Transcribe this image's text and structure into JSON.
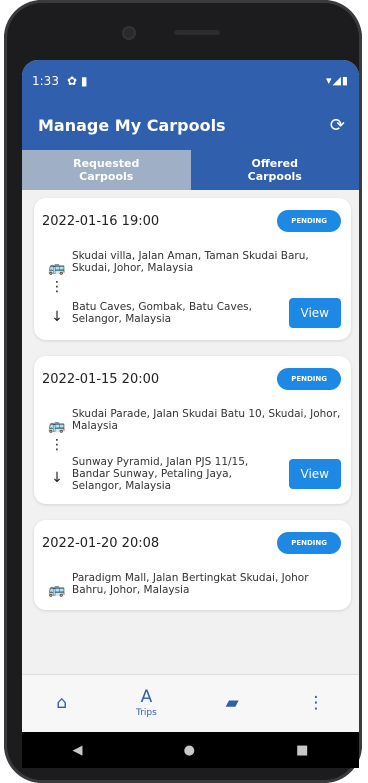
{
  "status_bar": {
    "time": "1:33",
    "icons_left": "✿ ▮",
    "icons_right": "▾◢▮"
  },
  "app_bar": {
    "title": "Manage My Carpools",
    "refresh_icon": "⟳"
  },
  "tabs": [
    {
      "label": "Requested Carpools",
      "active": true
    },
    {
      "label": "Offered Carpools",
      "active": false
    }
  ],
  "cards": [
    {
      "datetime": "2022-01-16 19:00",
      "status": "PENDING",
      "from": "Skudai villa, Jalan Aman, Taman Skudai Baru, Skudai, Johor, Malaysia",
      "to": "Batu Caves, Gombak, Batu Caves, Selangor, Malaysia",
      "button": "View"
    },
    {
      "datetime": "2022-01-15 20:00",
      "status": "PENDING",
      "from": "Skudai Parade, Jalan Skudai Batu 10, Skudai, Johor, Malaysia",
      "to": "Sunway Pyramid, Jalan PJS 11/15, Bandar Sunway, Petaling Jaya, Selangor, Malaysia",
      "button": "View"
    },
    {
      "datetime": "2022-01-20 20:08",
      "status": "PENDING",
      "from": "Paradigm Mall, Jalan Bertingkat Skudai, Johor Bahru, Johor, Malaysia",
      "to": "",
      "button": ""
    }
  ],
  "bottom_nav": {
    "home_icon": "home-icon",
    "trips_label": "Trips",
    "chat_icon": "chat-icon",
    "more_icon": "more-icon"
  },
  "glyphs": {
    "bus": "🚌",
    "dots": "⋮",
    "arrow": "↓",
    "trips": "A",
    "home": "⌂",
    "chat": "▰",
    "more": "⋮"
  },
  "system_nav": {
    "back": "◀",
    "home": "●",
    "recents": "■"
  },
  "colors": {
    "primary": "#2f5fad",
    "accent": "#1e88e5",
    "tab_active_bg": "#9fb0c6"
  }
}
